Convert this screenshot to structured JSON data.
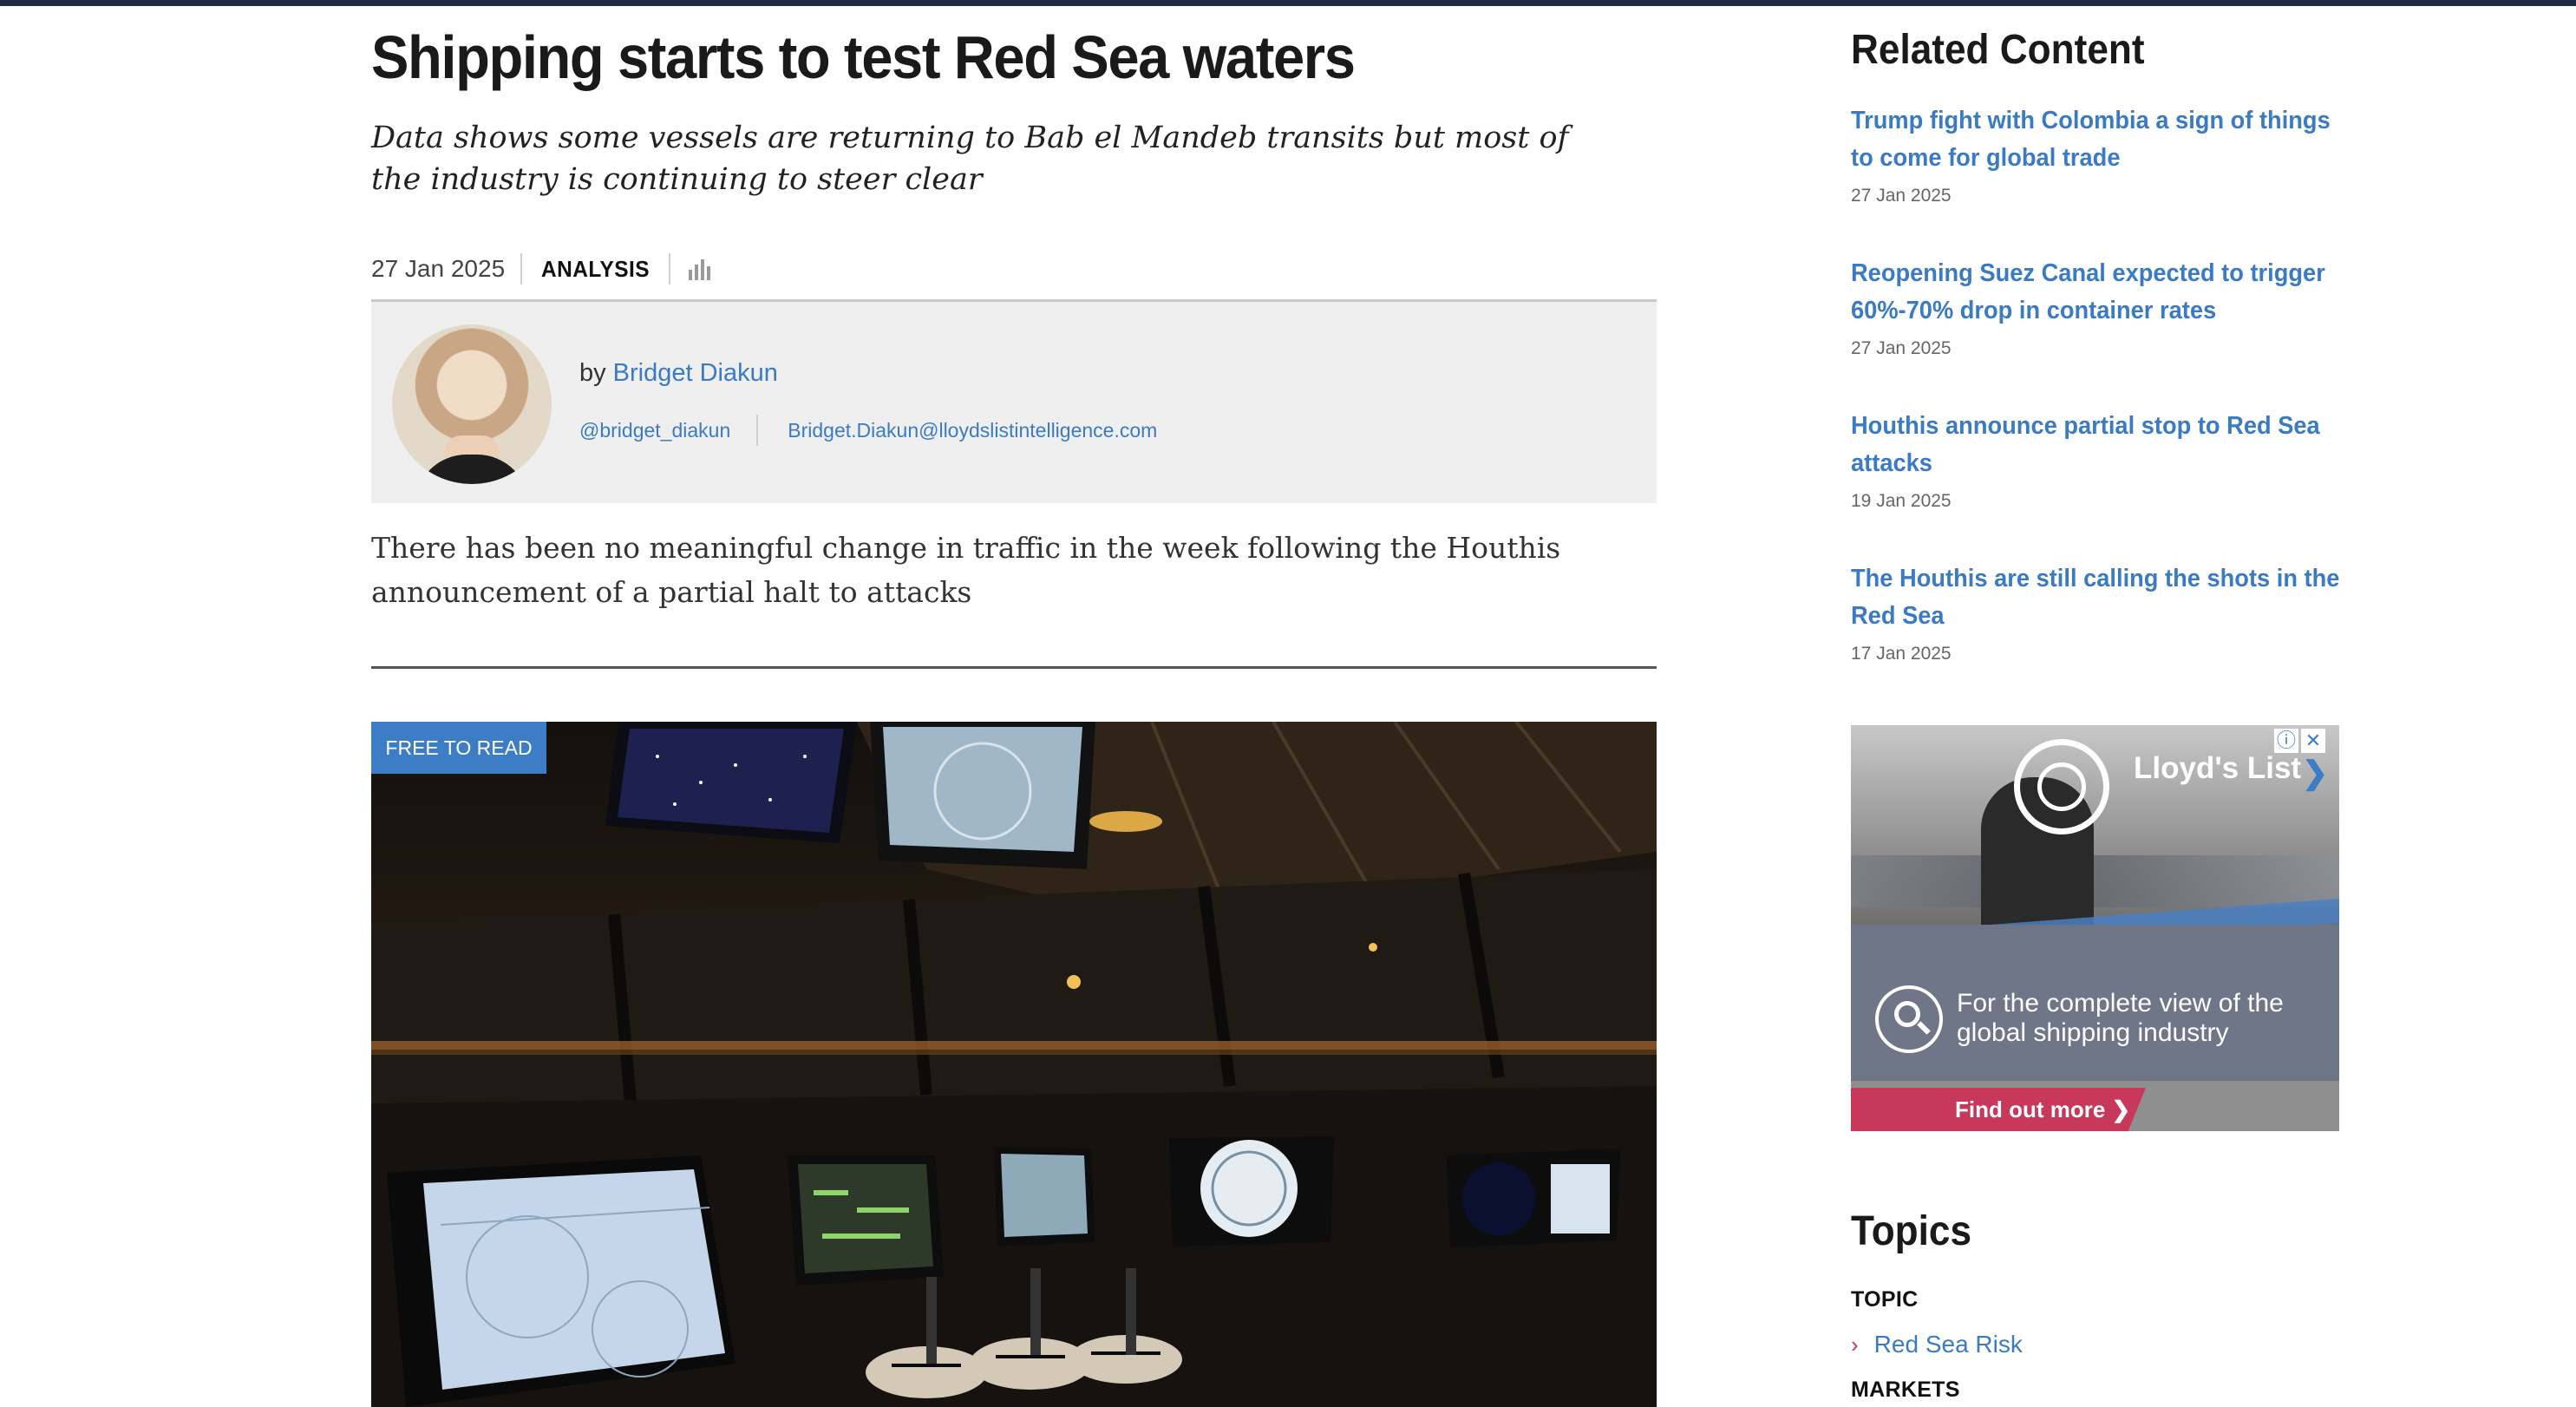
{
  "article": {
    "headline": "Shipping starts to test Red Sea waters",
    "standfirst": "Data shows some vessels are returning to Bab el Mandeb transits but most of the industry is continuing to steer clear",
    "date": "27 Jan 2025",
    "type": "ANALYSIS",
    "chart_icon": "bar-chart-icon",
    "author": {
      "by": "by",
      "name": "Bridget Diakun",
      "twitter": "@bridget_diakun",
      "email": "Bridget.Diakun@lloydslistintelligence.com"
    },
    "summary": "There has been no meaningful change in traffic in the week following the Houthis announcement of a partial halt to attacks",
    "badge": "FREE TO READ"
  },
  "sidebar": {
    "related_title": "Related Content",
    "related": [
      {
        "title": "Trump fight with Colombia a sign of things to come for global trade",
        "date": "27 Jan 2025"
      },
      {
        "title": "Reopening Suez Canal expected to trigger 60%-70% drop in container rates",
        "date": "27 Jan 2025"
      },
      {
        "title": "Houthis announce partial stop to Red Sea attacks",
        "date": "19 Jan 2025"
      },
      {
        "title": "The Houthis are still calling the shots in the Red Sea",
        "date": "17 Jan 2025"
      }
    ],
    "ad": {
      "brand": "Lloyd's List",
      "copy": "For the complete view of the global shipping industry",
      "cta": "Find out more ❯",
      "info_glyph": "ⓘ",
      "close_glyph": "✕"
    },
    "topics_title": "Topics",
    "topic_label": "TOPIC",
    "topic_link": "Red Sea Risk",
    "markets_label": "MARKETS"
  },
  "colors": {
    "link": "#3a7bc4",
    "top_bar": "#1c2a44",
    "badge": "#3c7dc6",
    "cta": "#c7385a"
  }
}
